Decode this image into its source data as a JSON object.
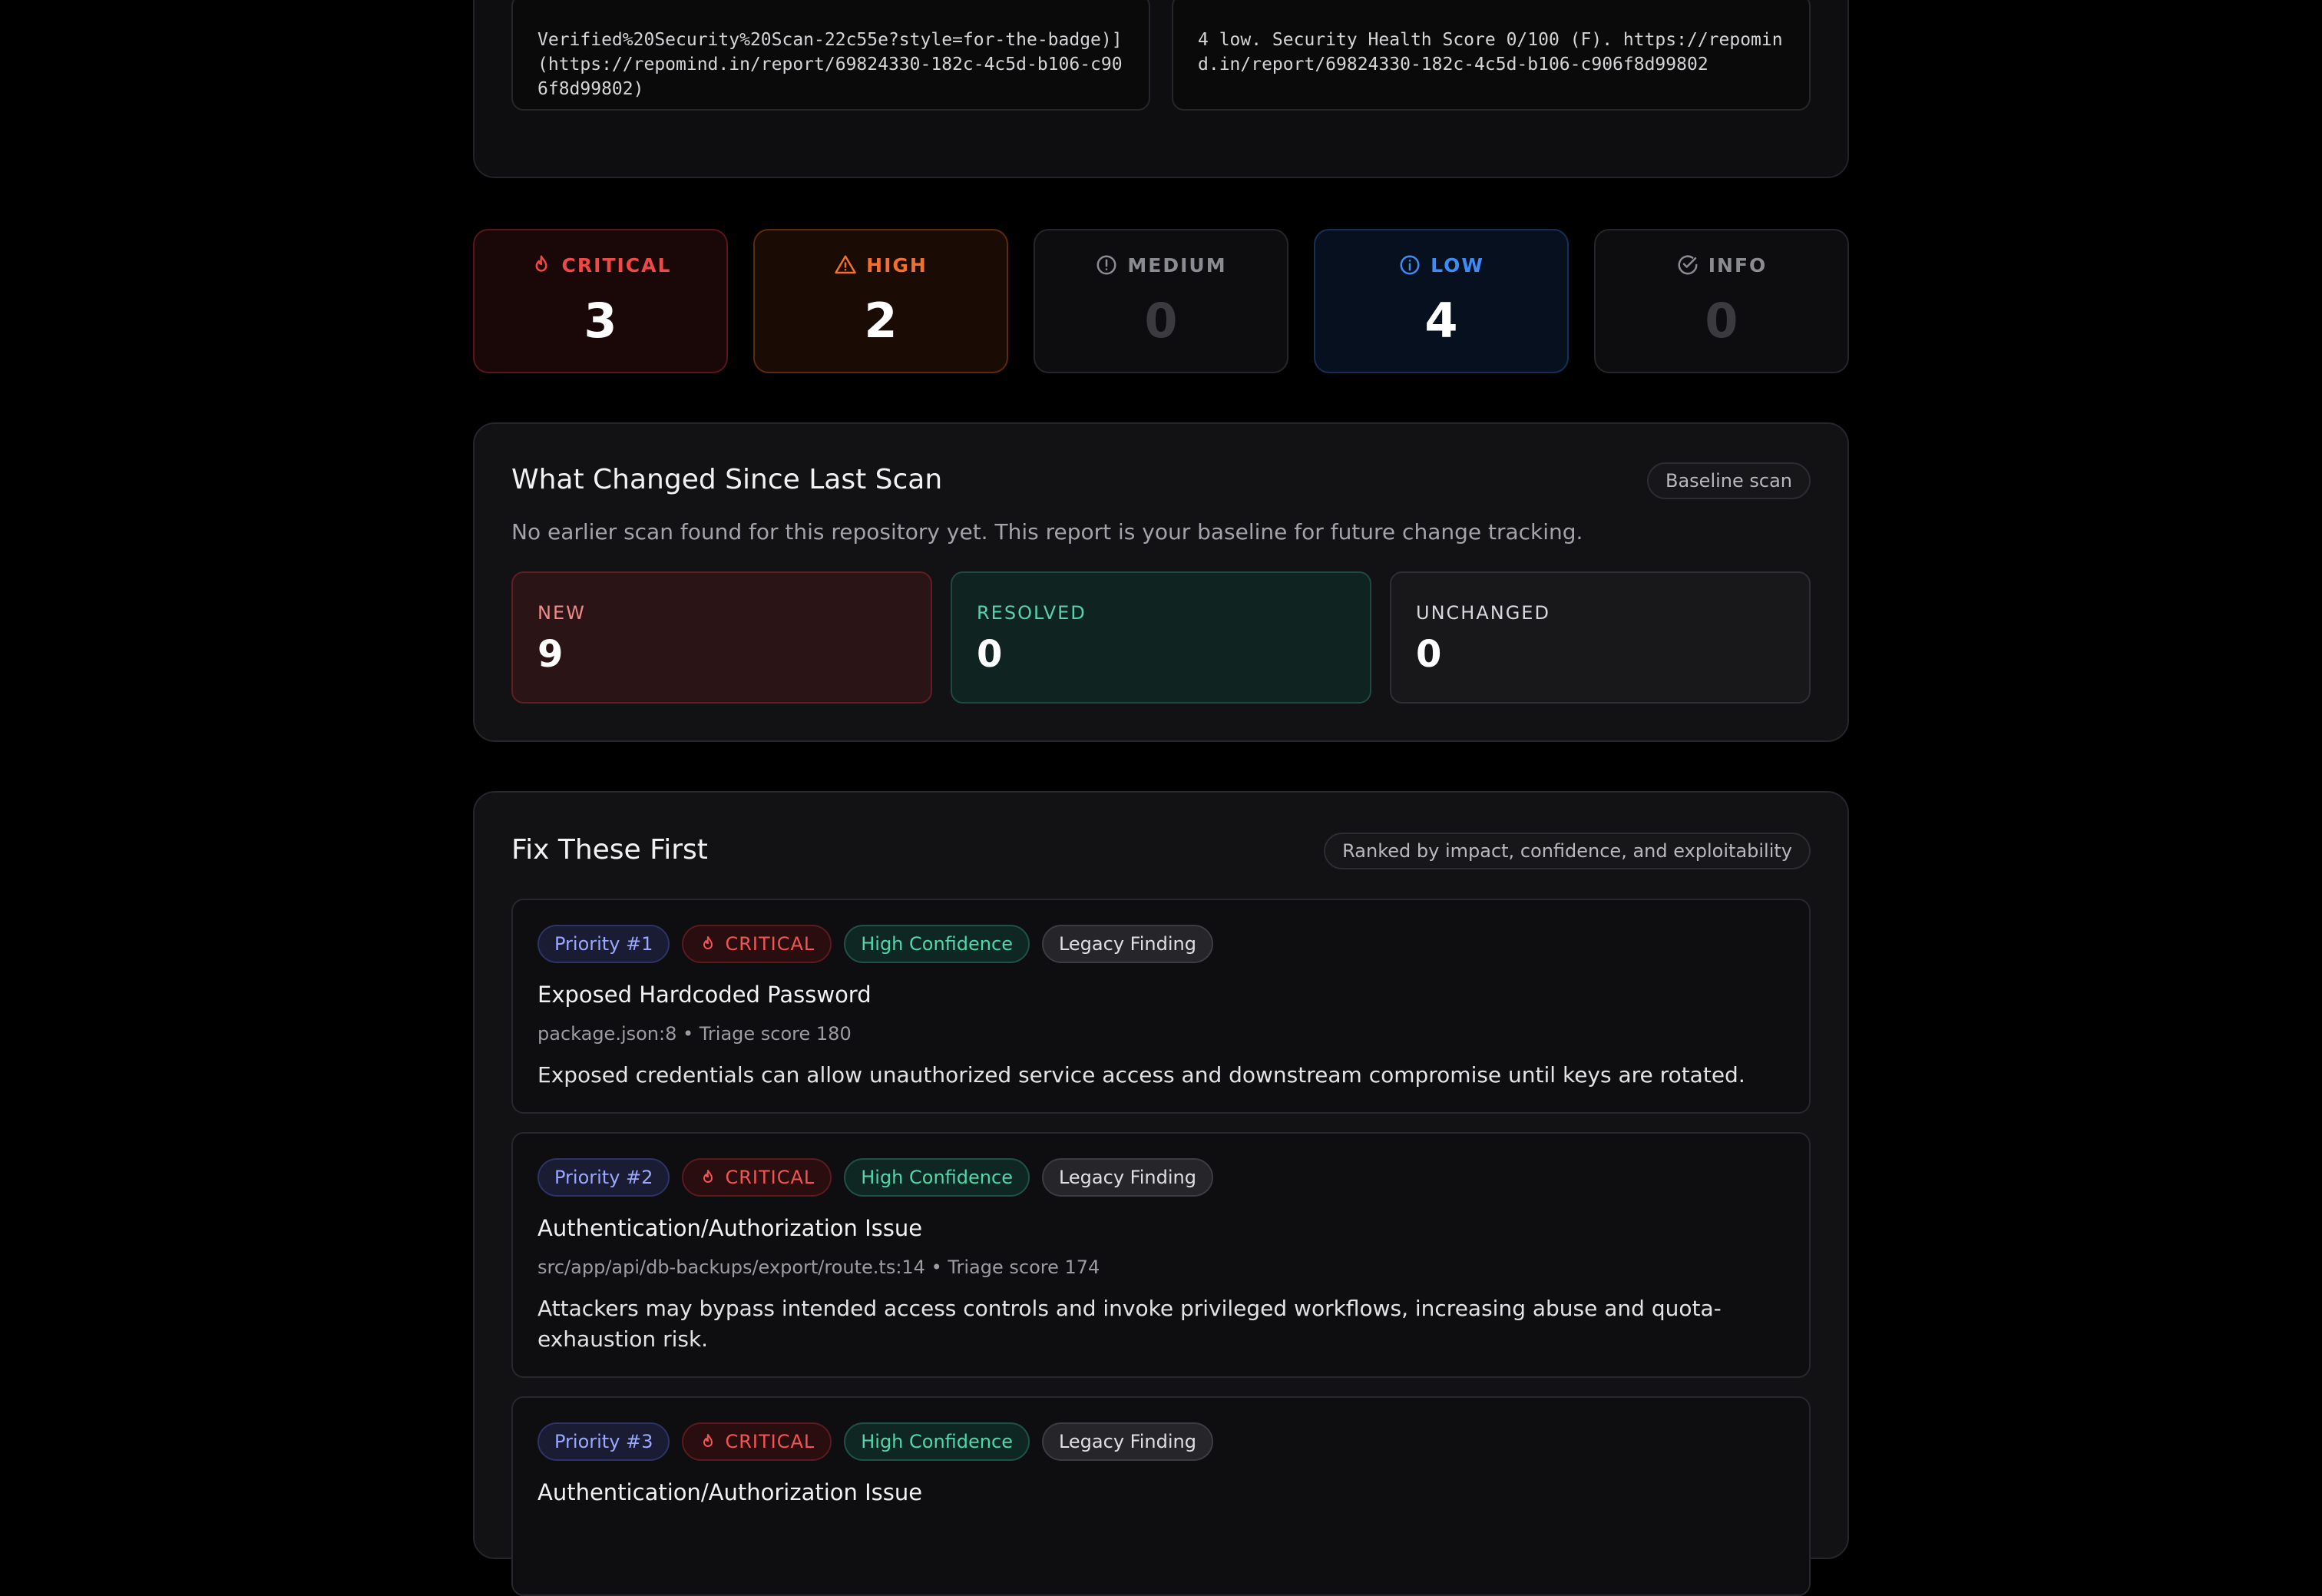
{
  "embed": {
    "left_code": "Verified%20Security%20Scan-22c55e?style=for-the-badge)](https://repomind.in/report/69824330-182c-4c5d-b106-c906f8d99802)",
    "right_code": "4 low. Security Health Score 0/100 (F). https://repomind.in/report/69824330-182c-4c5d-b106-c906f8d99802"
  },
  "severity": {
    "critical": {
      "label": "CRITICAL",
      "count": "3",
      "icon": "flame-icon",
      "color": "#f04747"
    },
    "high": {
      "label": "HIGH",
      "count": "2",
      "icon": "warning-triangle-icon",
      "color": "#f2702c"
    },
    "medium": {
      "label": "MEDIUM",
      "count": "0",
      "icon": "alert-circle-icon",
      "color": "#8b8b92"
    },
    "low": {
      "label": "LOW",
      "count": "4",
      "icon": "info-circle-icon",
      "color": "#3d8bf5"
    },
    "info": {
      "label": "INFO",
      "count": "0",
      "icon": "check-circle-icon",
      "color": "#8b8b92"
    }
  },
  "changes": {
    "title": "What Changed Since Last Scan",
    "badge": "Baseline scan",
    "description": "No earlier scan found for this repository yet. This report is your baseline for future change tracking.",
    "new": {
      "label": "NEW",
      "value": "9"
    },
    "resolved": {
      "label": "RESOLVED",
      "value": "0"
    },
    "unchanged": {
      "label": "UNCHANGED",
      "value": "0"
    }
  },
  "fix_first": {
    "title": "Fix These First",
    "badge": "Ranked by impact, confidence, and exploitability",
    "items": [
      {
        "priority": "Priority #1",
        "severity": "CRITICAL",
        "confidence": "High Confidence",
        "status": "Legacy Finding",
        "title": "Exposed Hardcoded Password",
        "meta": "package.json:8 • Triage score 180",
        "description": "Exposed credentials can allow unauthorized service access and downstream compromise until keys are rotated."
      },
      {
        "priority": "Priority #2",
        "severity": "CRITICAL",
        "confidence": "High Confidence",
        "status": "Legacy Finding",
        "title": "Authentication/Authorization Issue",
        "meta": "src/app/api/db-backups/export/route.ts:14 • Triage score 174",
        "description": "Attackers may bypass intended access controls and invoke privileged workflows, increasing abuse and quota-exhaustion risk."
      },
      {
        "priority": "Priority #3",
        "severity": "CRITICAL",
        "confidence": "High Confidence",
        "status": "Legacy Finding",
        "title": "Authentication/Authorization Issue"
      }
    ]
  }
}
